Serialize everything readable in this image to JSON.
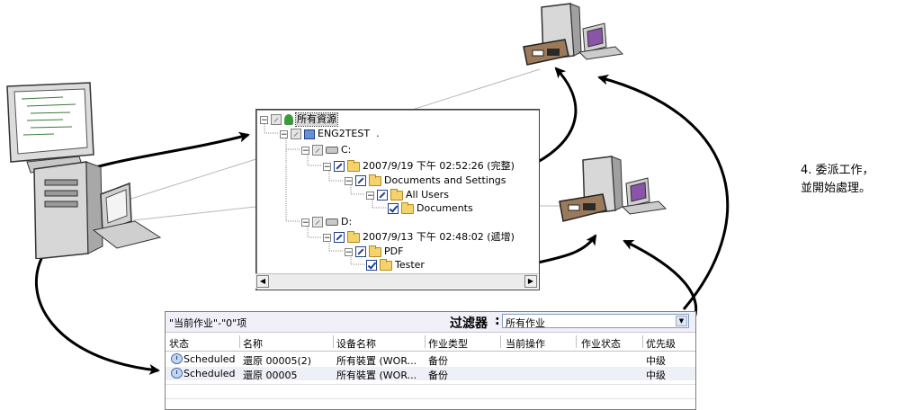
{
  "tree": {
    "root_label": "所有資源",
    "computer_label": "ENG2TEST",
    "drive_c": "C:",
    "backup_c": "2007/9/19 下午 02:52:26 (完整)",
    "docs_settings": "Documents and Settings",
    "all_users": "All Users",
    "documents": "Documents",
    "drive_d": "D:",
    "backup_d": "2007/9/13 下午 02:48:02 (遞增)",
    "pdf": "PDF",
    "tester": "Tester",
    "dot": "."
  },
  "job_panel": {
    "title": "\"当前作业\"-\"0\"项",
    "filter_label": "过滤器",
    "filter_value": "所有作业",
    "columns": [
      "状态",
      "名称",
      "设备名称",
      "作业类型",
      "当前操作",
      "作业状态",
      "优先级"
    ],
    "rows": [
      [
        "Scheduled",
        "還原 00005(2)",
        "所有裝置 (WOR...",
        "备份",
        "",
        "",
        "中级"
      ],
      [
        "Scheduled",
        "還原 00005",
        "所有裝置 (WOR...",
        "备份",
        "",
        "",
        "中级"
      ]
    ]
  },
  "caption": {
    "line1": "4. 委派工作，",
    "line2": "並開始處理。"
  },
  "colors": {
    "arrow": "#000000",
    "connector": "#b0b0b0",
    "header_bg": "#f1eff8"
  }
}
